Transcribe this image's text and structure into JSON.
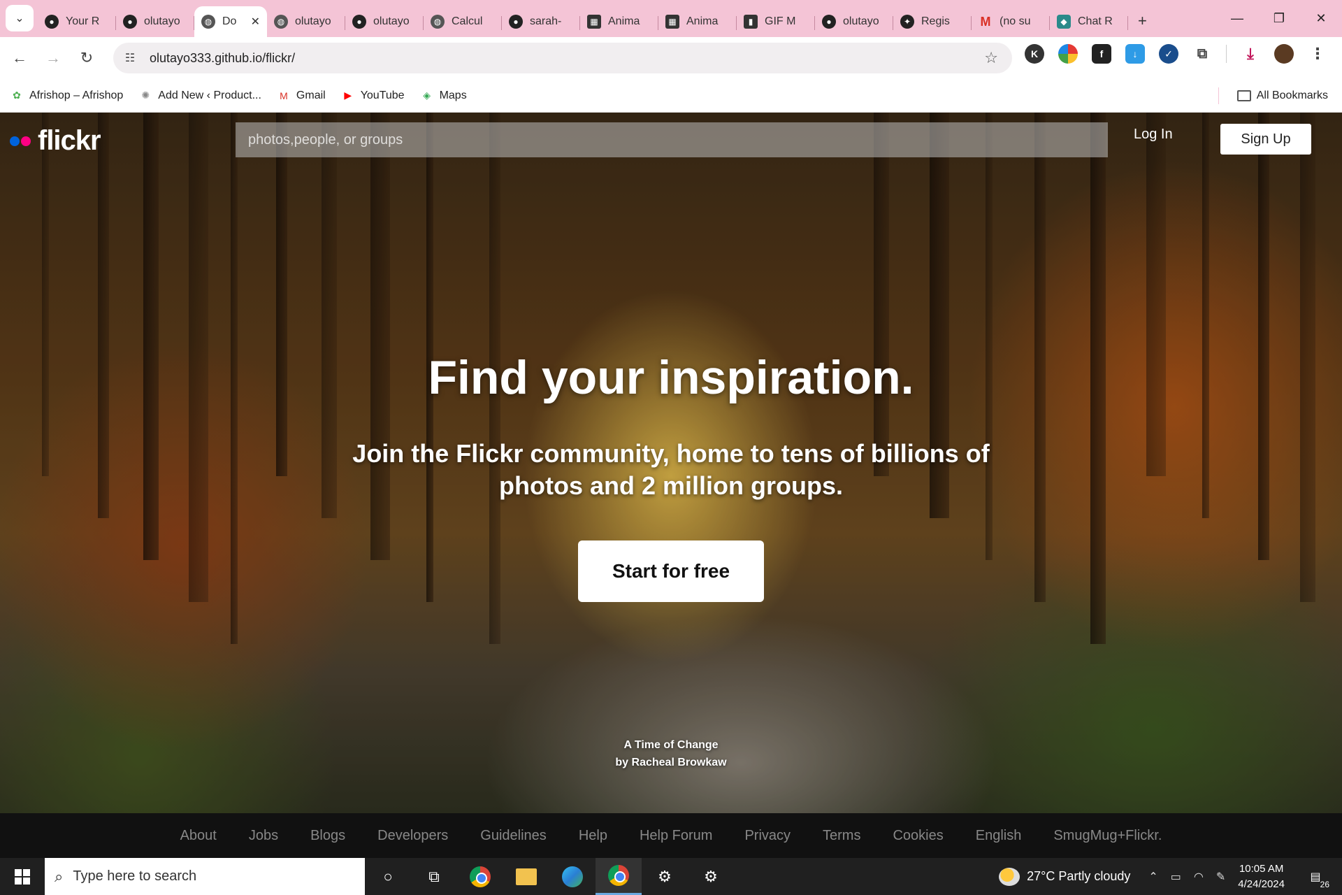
{
  "browser": {
    "tabs": [
      {
        "title": "Your R",
        "icon": "github-icon",
        "active": false
      },
      {
        "title": "olutayo",
        "icon": "github-icon",
        "active": false
      },
      {
        "title": "Do",
        "icon": "globe-icon",
        "active": true
      },
      {
        "title": "olutayo",
        "icon": "globe-icon",
        "active": false
      },
      {
        "title": "olutayo",
        "icon": "github-icon",
        "active": false
      },
      {
        "title": "Calcul",
        "icon": "globe-icon",
        "active": false
      },
      {
        "title": "sarah-",
        "icon": "github-icon",
        "active": false
      },
      {
        "title": "Anima",
        "icon": "animation-icon",
        "active": false
      },
      {
        "title": "Anima",
        "icon": "animation-icon",
        "active": false
      },
      {
        "title": "GIF M",
        "icon": "document-icon",
        "active": false
      },
      {
        "title": "olutayo",
        "icon": "github-icon",
        "active": false
      },
      {
        "title": "Regis",
        "icon": "register-icon",
        "active": false
      },
      {
        "title": "(no su",
        "icon": "gmail-icon",
        "active": false
      },
      {
        "title": "Chat R",
        "icon": "chat-icon",
        "active": false
      }
    ],
    "url": "olutayo333.github.io/flickr/",
    "bookmarks": [
      {
        "label": "Afrishop – Afrishop",
        "icon": "afrishop-icon",
        "color": "#4caf50"
      },
      {
        "label": "Add New ‹ Product...",
        "icon": "wordpress-icon",
        "color": "#888888"
      },
      {
        "label": "Gmail",
        "icon": "gmail-icon",
        "color": "#d93025"
      },
      {
        "label": "YouTube",
        "icon": "youtube-icon",
        "color": "#ff0000"
      },
      {
        "label": "Maps",
        "icon": "maps-icon",
        "color": "#34a853"
      }
    ],
    "all_bookmarks": "All Bookmarks"
  },
  "flickr": {
    "logo_text": "flickr",
    "logo_colors": [
      "#0063dc",
      "#ff0084"
    ],
    "search_placeholder": "photos,people, or groups",
    "login_label": "Log In",
    "signup_label": "Sign Up",
    "hero_title": "Find your inspiration.",
    "hero_subtitle": "Join the Flickr community, home to tens of billions of photos and 2 million groups.",
    "cta_label": "Start for free",
    "photo_title": "A Time of Change",
    "photo_author": "by Racheal Browkaw",
    "footer_links": [
      "About",
      "Jobs",
      "Blogs",
      "Developers",
      "Guidelines",
      "Help",
      "Help Forum",
      "Privacy",
      "Terms",
      "Cookies",
      "English",
      "SmugMug+Flickr."
    ]
  },
  "taskbar": {
    "search_placeholder": "Type here to search",
    "weather": "27°C  Partly cloudy",
    "time": "10:05 AM",
    "date": "4/24/2024",
    "notification_count": "26"
  }
}
